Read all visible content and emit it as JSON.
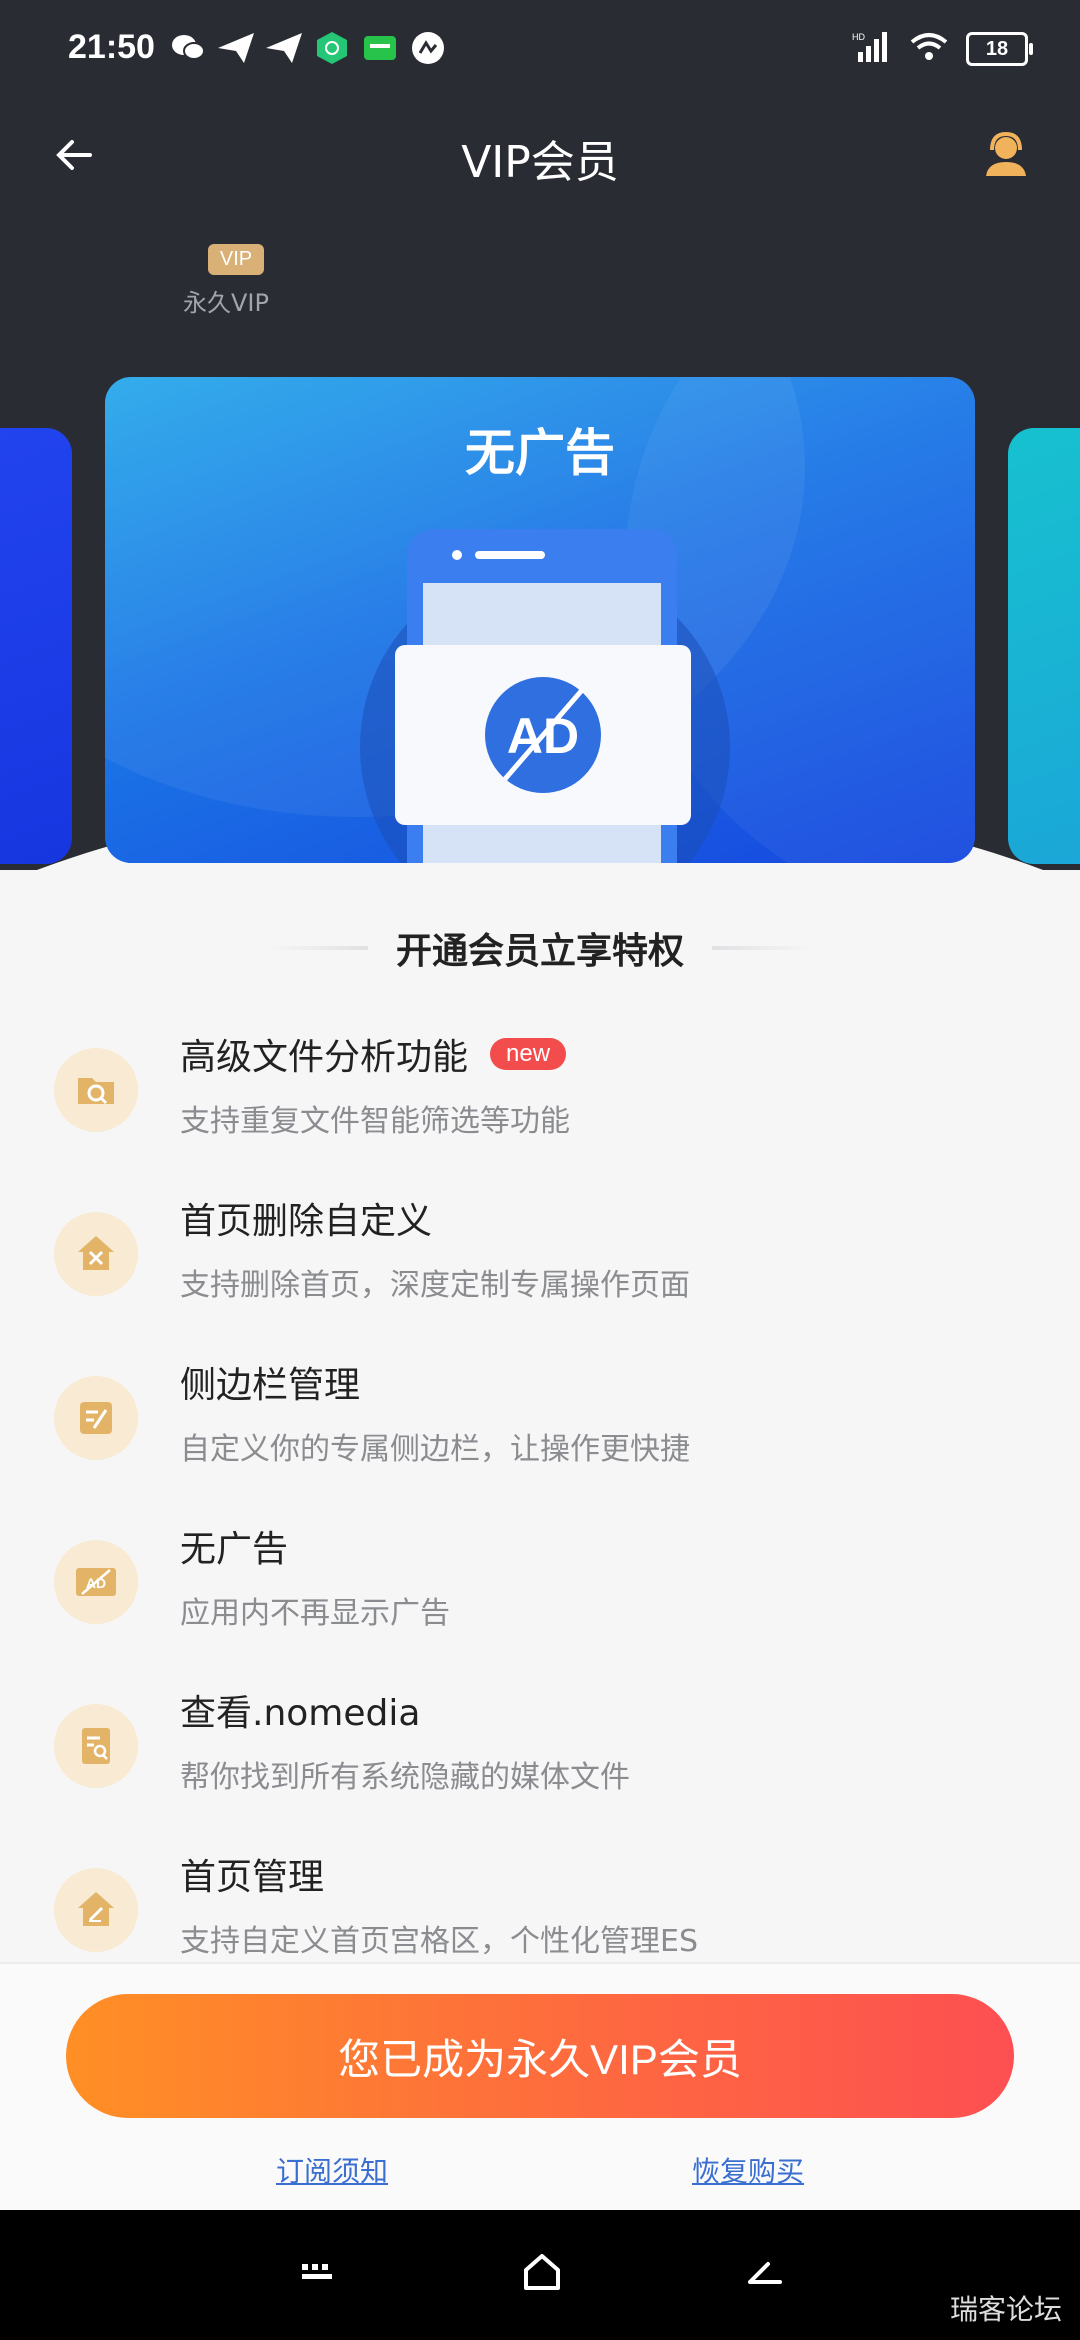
{
  "status_bar": {
    "time": "21:50",
    "battery": "18",
    "left_icons": [
      "wechat-icon",
      "send-icon",
      "send-icon",
      "app-store-icon",
      "iqiyi-icon",
      "ocr-icon"
    ],
    "right_icons": [
      "signal-hd-icon",
      "wifi-icon",
      "battery-icon"
    ]
  },
  "nav": {
    "title": "VIP会员",
    "back_icon": "arrow-left-icon",
    "service_icon": "customer-service-icon"
  },
  "tier": {
    "badge": "VIP",
    "label": "永久VIP"
  },
  "carousel": {
    "main_card_title": "无广告",
    "main_card_image_text": "AD"
  },
  "section_title": "开通会员立享特权",
  "features": [
    {
      "title": "高级文件分析功能",
      "badge": "new",
      "desc": "支持重复文件智能筛选等功能",
      "icon": "folder-search-icon"
    },
    {
      "title": "首页删除自定义",
      "badge": "",
      "desc": "支持删除首页，深度定制专属操作页面",
      "icon": "home-delete-icon"
    },
    {
      "title": "侧边栏管理",
      "badge": "",
      "desc": "自定义你的专属侧边栏，让操作更快捷",
      "icon": "sidebar-edit-icon"
    },
    {
      "title": "无广告",
      "badge": "",
      "desc": "应用内不再显示广告",
      "icon": "no-ad-icon"
    },
    {
      "title": "查看.nomedia",
      "badge": "",
      "desc": "帮你找到所有系统隐藏的媒体文件",
      "icon": "file-search-icon"
    },
    {
      "title": "首页管理",
      "badge": "",
      "desc": "支持自定义首页宫格区，个性化管理ES",
      "icon": "home-edit-icon"
    }
  ],
  "bottom": {
    "cta_label": "您已成为永久VIP会员",
    "link_terms": "订阅须知",
    "link_restore": "恢复购买"
  },
  "system_nav": {
    "icons": [
      "menu-icon",
      "home-icon",
      "back-icon"
    ]
  },
  "watermark": "瑞客论坛",
  "colors": {
    "header_bg": "#2a2c33",
    "accent_gold": "#d9b076",
    "cta_start": "#ff8f25",
    "cta_end": "#fd4f52",
    "new_badge": "#f24c4c",
    "link": "#3a6fd1"
  }
}
